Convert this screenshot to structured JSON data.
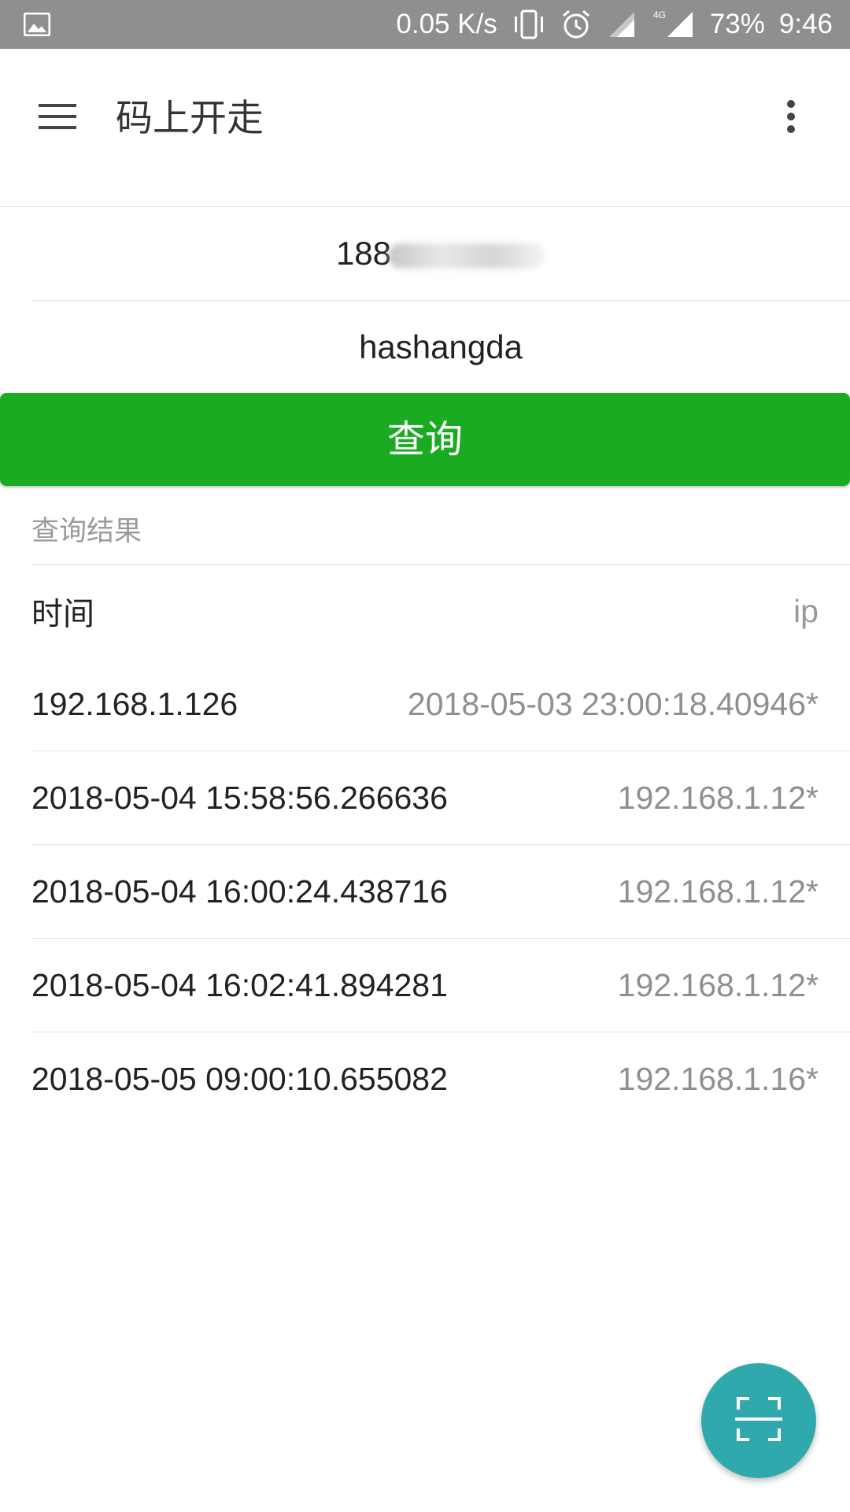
{
  "status_bar": {
    "network_speed": "0.05 K/s",
    "network_type": "4G",
    "battery": "73%",
    "time": "9:46",
    "icons": [
      "image-icon",
      "vibrate-icon",
      "alarm-icon",
      "signal-icon",
      "signal-4g-icon"
    ]
  },
  "app_bar": {
    "title": "码上开走",
    "menu_icon": "hamburger-menu-icon",
    "more_icon": "more-vert-icon"
  },
  "form": {
    "phone_value_visible": "188",
    "name_value": "hashangda",
    "query_button_label": "查询"
  },
  "results": {
    "caption": "查询结果",
    "header": {
      "left": "时间",
      "right": "ip"
    },
    "rows": [
      {
        "left": "192.168.1.126",
        "right": "2018-05-03 23:00:18.40946*"
      },
      {
        "left": "2018-05-04 15:58:56.266636",
        "right": "192.168.1.12*"
      },
      {
        "left": "2018-05-04 16:00:24.438716",
        "right": "192.168.1.12*"
      },
      {
        "left": "2018-05-04 16:02:41.894281",
        "right": "192.168.1.12*"
      },
      {
        "left": "2018-05-05 09:00:10.655082",
        "right": "192.168.1.16*"
      }
    ]
  },
  "fab": {
    "icon": "scan-icon"
  },
  "colors": {
    "status_bar": "#8f8f8f",
    "primary_green": "#1aab22",
    "fab_teal": "#2fa9ab",
    "secondary_text": "#8f8f8f"
  }
}
